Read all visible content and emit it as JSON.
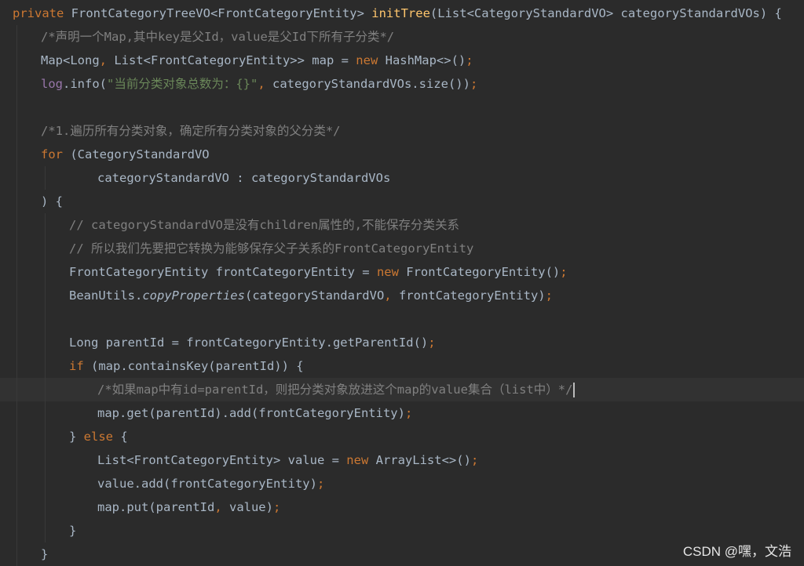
{
  "editor": {
    "lines": [
      {
        "indent": 0,
        "tokens": [
          {
            "t": "private ",
            "c": "kw"
          },
          {
            "t": "FrontCategoryTreeVO<FrontCategoryEntity> ",
            "c": "plain"
          },
          {
            "t": "initTree",
            "c": "fn"
          },
          {
            "t": "(List<CategoryStandardVO> categoryStandardVOs) {",
            "c": "plain"
          }
        ]
      },
      {
        "indent": 1,
        "tokens": [
          {
            "t": "/*声明一个Map,其中key是父Id，value是父Id下所有子分类*/",
            "c": "cm"
          }
        ]
      },
      {
        "indent": 1,
        "tokens": [
          {
            "t": "Map<Long",
            "c": "plain"
          },
          {
            "t": ", ",
            "c": "kw"
          },
          {
            "t": "List<FrontCategoryEntity>> map = ",
            "c": "plain"
          },
          {
            "t": "new ",
            "c": "kw"
          },
          {
            "t": "HashMap<>()",
            "c": "plain"
          },
          {
            "t": ";",
            "c": "kw"
          }
        ]
      },
      {
        "indent": 1,
        "tokens": [
          {
            "t": "log",
            "c": "fld"
          },
          {
            "t": ".info(",
            "c": "plain"
          },
          {
            "t": "\"当前分类对象总数为：{}\"",
            "c": "str"
          },
          {
            "t": ", ",
            "c": "kw"
          },
          {
            "t": "categoryStandardVOs.size())",
            "c": "plain"
          },
          {
            "t": ";",
            "c": "kw"
          }
        ]
      },
      {
        "indent": 1,
        "tokens": []
      },
      {
        "indent": 1,
        "tokens": [
          {
            "t": "/*1.遍历所有分类对象，确定所有分类对象的父分类*/",
            "c": "cm"
          }
        ]
      },
      {
        "indent": 1,
        "tokens": [
          {
            "t": "for ",
            "c": "kw"
          },
          {
            "t": "(CategoryStandardVO",
            "c": "plain"
          }
        ]
      },
      {
        "indent": 3,
        "tokens": [
          {
            "t": "categoryStandardVO : categoryStandardVOs",
            "c": "plain"
          }
        ]
      },
      {
        "indent": 1,
        "tokens": [
          {
            "t": ") {",
            "c": "plain"
          }
        ]
      },
      {
        "indent": 2,
        "tokens": [
          {
            "t": "// categoryStandardVO是没有children属性的,不能保存分类关系",
            "c": "cm"
          }
        ]
      },
      {
        "indent": 2,
        "tokens": [
          {
            "t": "// 所以我们先要把它转换为能够保存父子关系的FrontCategoryEntity",
            "c": "cm"
          }
        ]
      },
      {
        "indent": 2,
        "tokens": [
          {
            "t": "FrontCategoryEntity frontCategoryEntity = ",
            "c": "plain"
          },
          {
            "t": "new ",
            "c": "kw"
          },
          {
            "t": "FrontCategoryEntity()",
            "c": "plain"
          },
          {
            "t": ";",
            "c": "kw"
          }
        ]
      },
      {
        "indent": 2,
        "tokens": [
          {
            "t": "BeanUtils.",
            "c": "plain"
          },
          {
            "t": "copyProperties",
            "c": "ital"
          },
          {
            "t": "(categoryStandardVO",
            "c": "plain"
          },
          {
            "t": ", ",
            "c": "kw"
          },
          {
            "t": "frontCategoryEntity)",
            "c": "plain"
          },
          {
            "t": ";",
            "c": "kw"
          }
        ]
      },
      {
        "indent": 2,
        "tokens": []
      },
      {
        "indent": 2,
        "tokens": [
          {
            "t": "Long parentId = frontCategoryEntity.getParentId()",
            "c": "plain"
          },
          {
            "t": ";",
            "c": "kw"
          }
        ]
      },
      {
        "indent": 2,
        "tokens": [
          {
            "t": "if ",
            "c": "kw"
          },
          {
            "t": "(map.containsKey(parentId)) {",
            "c": "plain"
          }
        ]
      },
      {
        "indent": 3,
        "current": true,
        "caret": true,
        "tokens": [
          {
            "t": "/*如果map中有id=parentId，则把分类对象放进这个map的value集合（list中）*/",
            "c": "cm"
          }
        ]
      },
      {
        "indent": 3,
        "tokens": [
          {
            "t": "map.get(parentId).add(frontCategoryEntity)",
            "c": "plain"
          },
          {
            "t": ";",
            "c": "kw"
          }
        ]
      },
      {
        "indent": 2,
        "tokens": [
          {
            "t": "} ",
            "c": "plain"
          },
          {
            "t": "else ",
            "c": "kw"
          },
          {
            "t": "{",
            "c": "plain"
          }
        ]
      },
      {
        "indent": 3,
        "tokens": [
          {
            "t": "List<FrontCategoryEntity> value = ",
            "c": "plain"
          },
          {
            "t": "new ",
            "c": "kw"
          },
          {
            "t": "ArrayList<>()",
            "c": "plain"
          },
          {
            "t": ";",
            "c": "kw"
          }
        ]
      },
      {
        "indent": 3,
        "tokens": [
          {
            "t": "value.add(frontCategoryEntity)",
            "c": "plain"
          },
          {
            "t": ";",
            "c": "kw"
          }
        ]
      },
      {
        "indent": 3,
        "tokens": [
          {
            "t": "map.put(parentId",
            "c": "plain"
          },
          {
            "t": ", ",
            "c": "kw"
          },
          {
            "t": "value)",
            "c": "plain"
          },
          {
            "t": ";",
            "c": "kw"
          }
        ]
      },
      {
        "indent": 2,
        "tokens": [
          {
            "t": "}",
            "c": "plain"
          }
        ]
      },
      {
        "indent": 1,
        "tokens": [
          {
            "t": "}",
            "c": "plain"
          }
        ]
      }
    ]
  },
  "watermark": "CSDN @嘿，文浩",
  "colors": {
    "background": "#2b2b2b",
    "keyword": "#cc7832",
    "method": "#ffc66d",
    "comment": "#808080",
    "string": "#6a8759",
    "field": "#9876aa",
    "text": "#a9b7c6"
  }
}
